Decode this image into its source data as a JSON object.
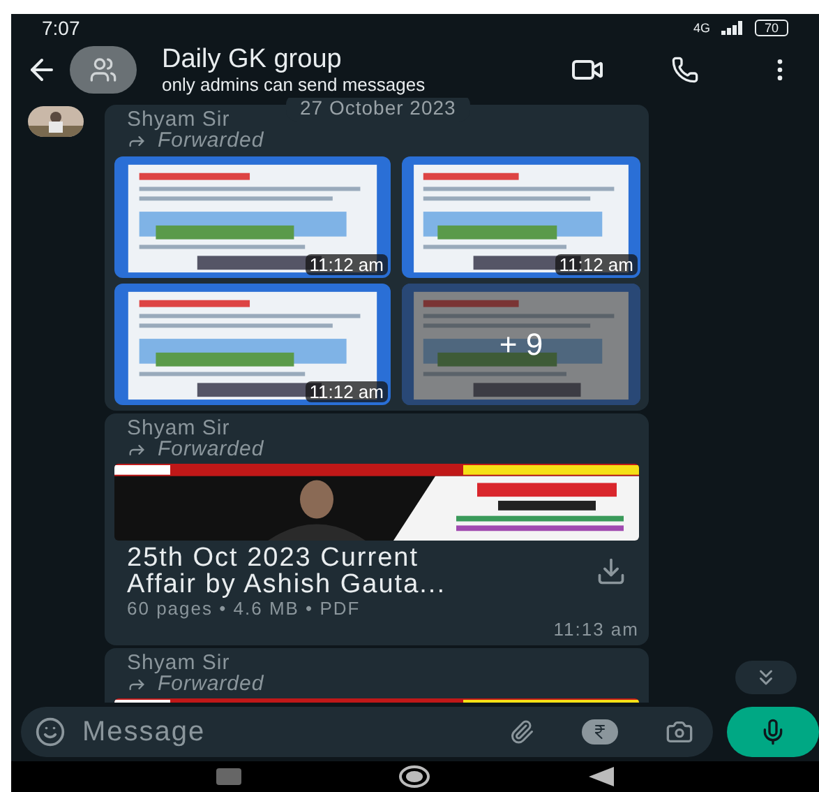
{
  "status_bar": {
    "time": "7:07",
    "network": "4G",
    "battery": "70"
  },
  "header": {
    "title": "Daily GK group",
    "subtitle": "only admins can send messages"
  },
  "date_chip": "27 October 2023",
  "messages": [
    {
      "kind": "album",
      "sender": "Shyam Sir",
      "forwarded": "Forwarded",
      "images": [
        {
          "time": "11:12 am"
        },
        {
          "time": "11:12 am"
        },
        {
          "time": "11:12 am"
        },
        {
          "more": "+ 9"
        }
      ]
    },
    {
      "kind": "document",
      "sender": "Shyam Sir",
      "forwarded": "Forwarded",
      "title": "25th Oct 2023 Current Affair by Ashish Gauta...",
      "meta": "60 pages • 4.6 MB • PDF",
      "time": "11:13 am"
    },
    {
      "kind": "document",
      "sender": "Shyam Sir",
      "forwarded": "Forwarded"
    }
  ],
  "composer": {
    "placeholder": "Message"
  }
}
